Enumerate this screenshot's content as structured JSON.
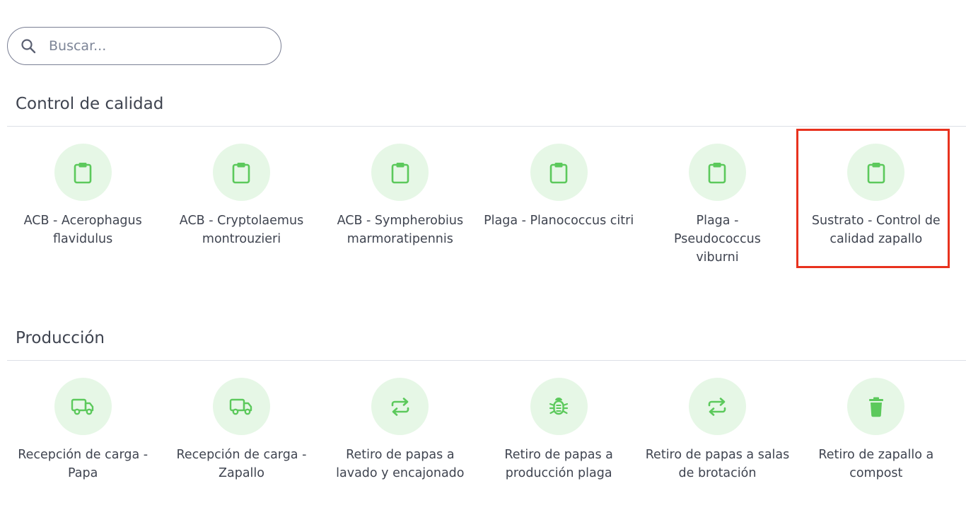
{
  "search": {
    "placeholder": "Buscar..."
  },
  "sections": [
    {
      "title": "Control de calidad",
      "items": [
        {
          "label": "ACB - Acerophagus flavidulus",
          "icon": "clipboard-icon"
        },
        {
          "label": "ACB - Cryptolaemus montrouzieri",
          "icon": "clipboard-icon"
        },
        {
          "label": "ACB - Sympherobius marmoratipennis",
          "icon": "clipboard-icon"
        },
        {
          "label": "Plaga - Planococcus citri",
          "icon": "clipboard-icon"
        },
        {
          "label": "Plaga - Pseudococcus viburni",
          "icon": "clipboard-icon"
        },
        {
          "label": "Sustrato - Control de calidad zapallo",
          "icon": "clipboard-icon"
        }
      ]
    },
    {
      "title": "Producción",
      "items": [
        {
          "label": "Recepción de carga - Papa",
          "icon": "truck-icon"
        },
        {
          "label": "Recepción de carga - Zapallo",
          "icon": "truck-icon"
        },
        {
          "label": "Retiro de papas a lavado y encajonado",
          "icon": "transfer-icon"
        },
        {
          "label": "Retiro de papas a producción plaga",
          "icon": "bug-icon"
        },
        {
          "label": "Retiro de papas a salas de brotación",
          "icon": "transfer-icon"
        },
        {
          "label": "Retiro de zapallo a compost",
          "icon": "trash-icon"
        }
      ]
    }
  ],
  "colors": {
    "accent": "#5cc95c",
    "circle_bg": "#e6f7e6",
    "highlight": "#e8321e"
  }
}
